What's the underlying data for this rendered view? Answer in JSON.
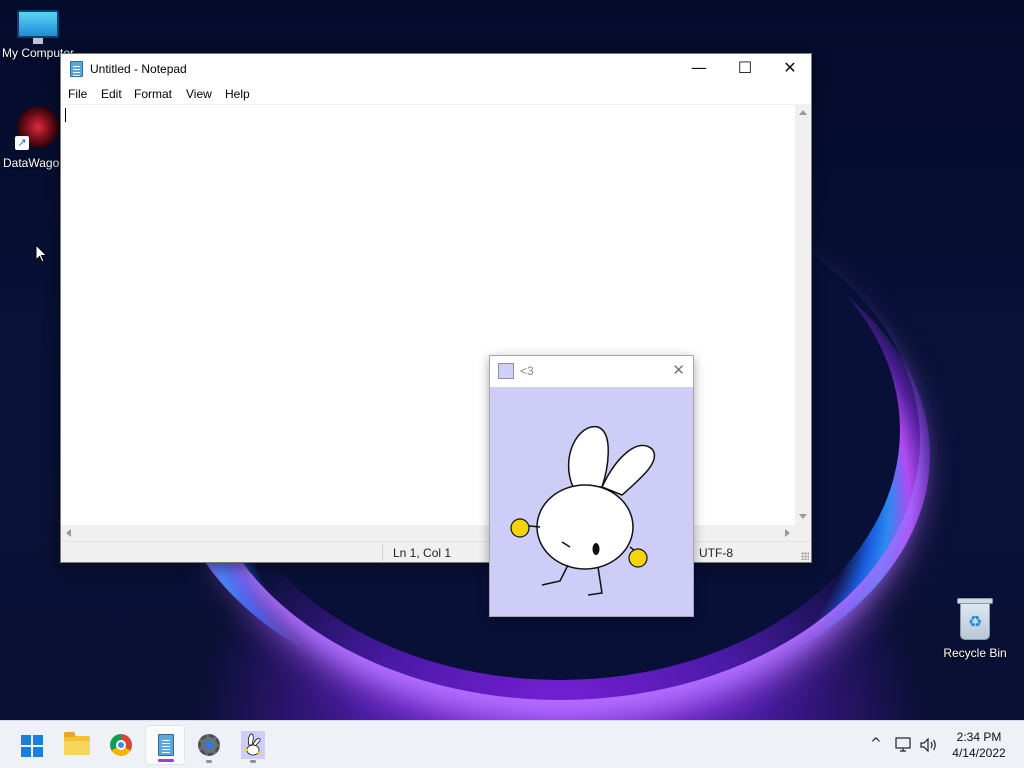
{
  "desktop": {
    "icons": [
      {
        "label": "My Computer"
      },
      {
        "label": "DataWagon"
      },
      {
        "label": "Recycle Bin"
      }
    ]
  },
  "notepad": {
    "title": "Untitled - Notepad",
    "menu": [
      "File",
      "Edit",
      "Format",
      "View",
      "Help"
    ],
    "content": "",
    "status": {
      "position": "Ln 1, Col 1",
      "encoding": "UTF-8"
    },
    "controls": {
      "minimize": "—",
      "maximize": "☐",
      "close": "✕"
    }
  },
  "pet_window": {
    "title": "<3",
    "close": "✕",
    "background": "#cdcdf7"
  },
  "taskbar": {
    "apps": [
      {
        "name": "Start",
        "icon": "windows-logo-icon"
      },
      {
        "name": "File Explorer",
        "icon": "folder-icon"
      },
      {
        "name": "Google Chrome",
        "icon": "chrome-icon"
      },
      {
        "name": "Notepad",
        "icon": "notepad-icon",
        "active": true
      },
      {
        "name": "Settings",
        "icon": "gear-icon"
      },
      {
        "name": "Desktop Pet",
        "icon": "bunny-icon"
      }
    ],
    "tray": {
      "overflow": "^",
      "time": "2:34 PM",
      "date": "4/14/2022"
    }
  },
  "colors": {
    "accent": "#a23ad6",
    "taskbar_bg": "#eef2f7",
    "pet_bg": "#cdcdf7"
  }
}
